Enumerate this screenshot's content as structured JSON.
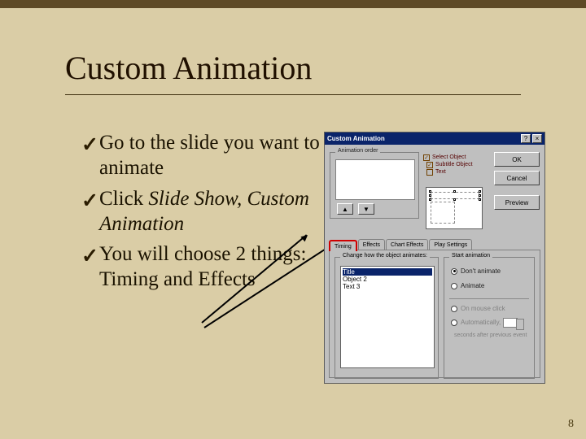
{
  "slide": {
    "heading": "Custom Animation",
    "page_number": "8",
    "bullets": [
      {
        "pre": "Go to the slide you want to animate"
      },
      {
        "pre": "Click ",
        "em": "Slide Show, Custom Animation"
      },
      {
        "pre": "You will choose 2 things:  Timing and Effects"
      }
    ]
  },
  "dialog": {
    "title": "Custom Animation",
    "help_btn": "?",
    "close_btn": "×",
    "order_group_title": "Animation order",
    "up_glyph": "▲",
    "down_glyph": "▼",
    "checklist": [
      "Select Object",
      "Subtitle Object",
      "Text"
    ],
    "btn_ok": "OK",
    "btn_cancel": "Cancel",
    "btn_preview": "Preview",
    "tabs": [
      "Timing",
      "Effects",
      "Chart Effects",
      "Play Settings"
    ],
    "left_group_title": "Change how the object animates:",
    "list_items": [
      "Title",
      "Object 2",
      "Text 3"
    ],
    "right_group_title": "Start animation",
    "radio_dont": "Don't animate",
    "radio_animate": "Animate",
    "radio_click": "On mouse click",
    "radio_auto": "Automatically,",
    "seconds_text": "seconds after previous event"
  }
}
